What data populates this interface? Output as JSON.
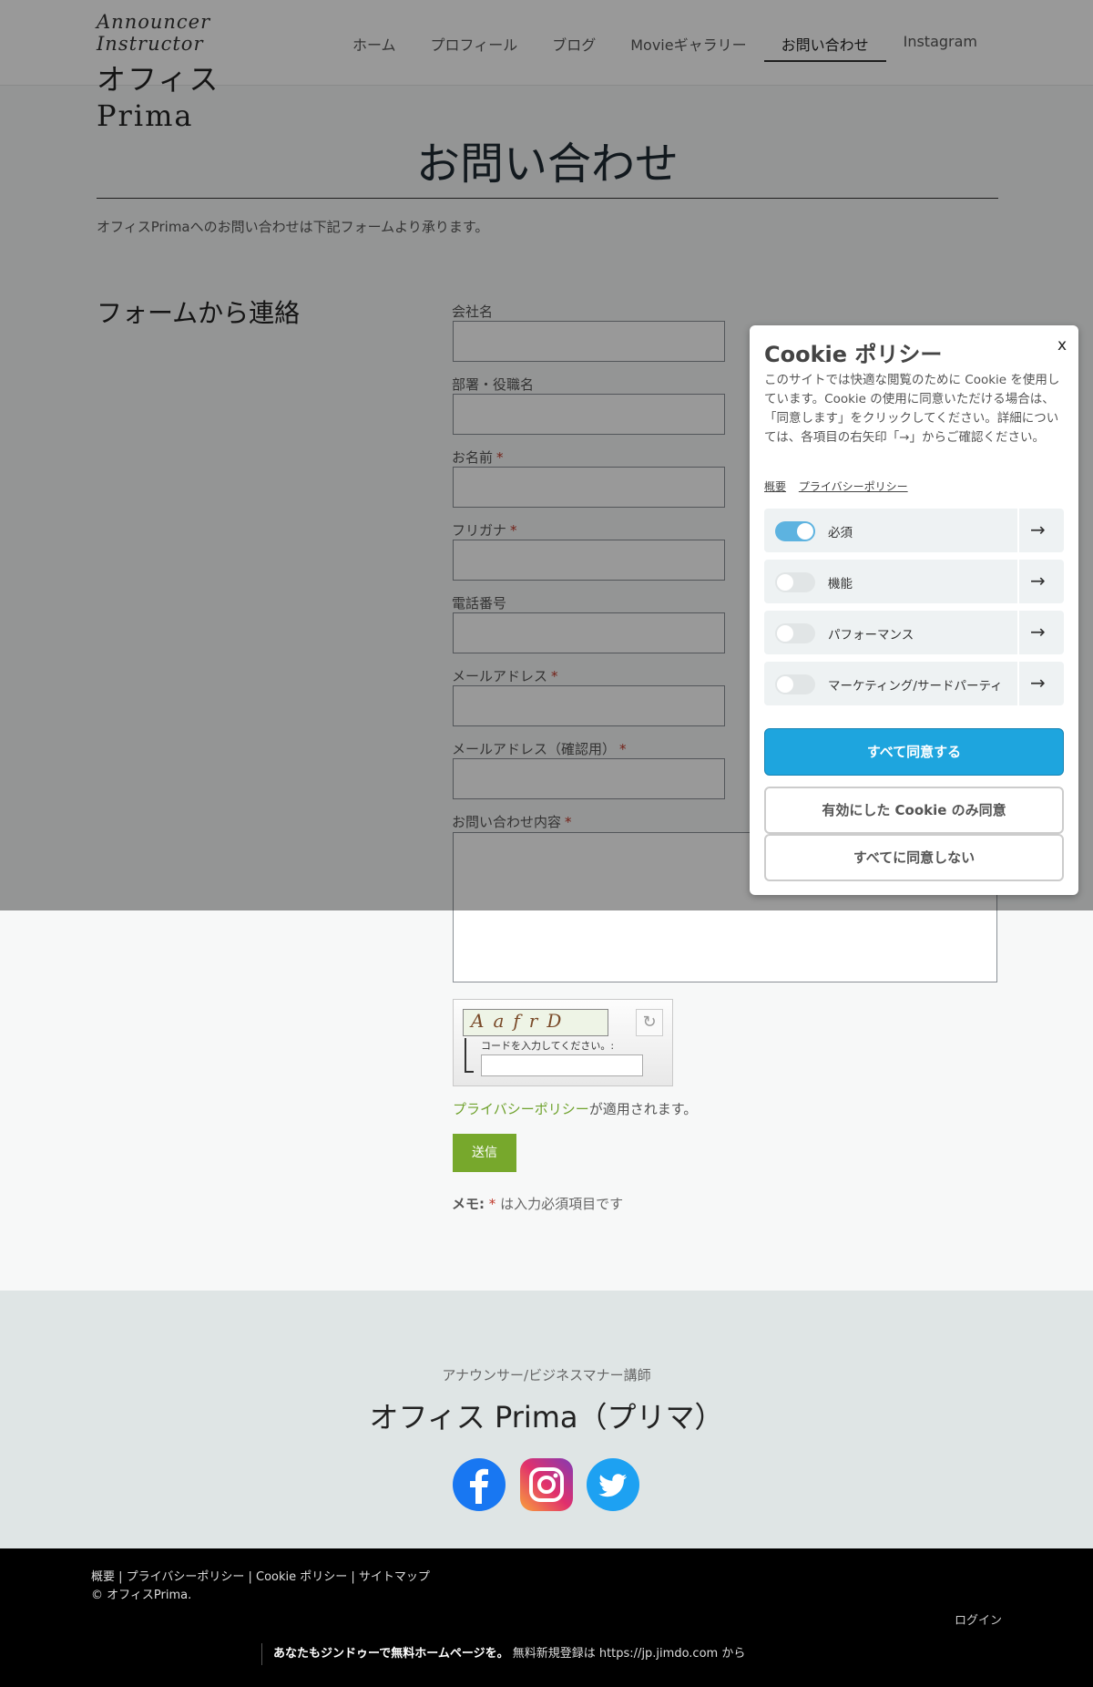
{
  "header": {
    "logo_script": "Announcer Instructor",
    "logo_brand": "オフィスPrima",
    "nav": [
      {
        "label": "ホーム"
      },
      {
        "label": "プロフィール"
      },
      {
        "label": "ブログ"
      },
      {
        "label": "Movieギャラリー"
      },
      {
        "label": "お問い合わせ",
        "active": true
      },
      {
        "label": "Instagram"
      }
    ]
  },
  "main": {
    "title": "お問い合わせ",
    "intro": "オフィスPrimaへのお問い合わせは下記フォームより承ります。",
    "section_heading": "フォームから連絡"
  },
  "form": {
    "fields": [
      {
        "label": "会社名",
        "required": false
      },
      {
        "label": "部署・役職名",
        "required": false
      },
      {
        "label": "お名前",
        "required": true
      },
      {
        "label": "フリガナ",
        "required": true
      },
      {
        "label": "電話番号",
        "required": false
      },
      {
        "label": "メールアドレス",
        "required": true
      },
      {
        "label": "メールアドレス（確認用）",
        "required": true
      },
      {
        "label": "お問い合わせ内容",
        "required": true
      }
    ],
    "required_mark": "*",
    "captcha_text": "AafrD",
    "captcha_label": "コードを入力してください。:",
    "privacy_link": "プライバシーポリシー",
    "privacy_suffix": "が適用されます。",
    "submit_label": "送信",
    "memo_prefix": "メモ:",
    "memo_star": "*",
    "memo_suffix": "は入力必須項目です"
  },
  "footer": {
    "subtitle": "アナウンサー/ビジネスマナー講師",
    "name": "オフィス Prima（プリマ）",
    "social": [
      "facebook",
      "instagram",
      "twitter"
    ],
    "links": "概要 | プライバシーポリシー | Cookie ポリシー | サイトマップ",
    "copyright": "© オフィスPrima.",
    "login": "ログイン",
    "jimdo_bold": "あなたもジンドゥーで無料ホームページを。",
    "jimdo_rest": " 無料新規登録は https://jp.jimdo.com から"
  },
  "cookie": {
    "title": "Cookie ポリシー",
    "close": "x",
    "description": "このサイトでは快適な閲覧のために Cookie を使用しています。Cookie の使用に同意いただける場合は、「同意します」をクリックしてください。詳細については、各項目の右矢印「→」からご確認ください。",
    "links": [
      "概要",
      "プライバシーポリシー"
    ],
    "categories": [
      {
        "label": "必須",
        "enabled": true
      },
      {
        "label": "機能",
        "enabled": false
      },
      {
        "label": "パフォーマンス",
        "enabled": false
      },
      {
        "label": "マーケティング/サードパーティ",
        "enabled": false
      }
    ],
    "arrow": "→",
    "accept_all": "すべて同意する",
    "accept_selected": "有効にした Cookie のみ同意",
    "reject_all": "すべてに同意しない"
  },
  "colors": {
    "accent_green": "#77a82c",
    "cookie_blue": "#1ea5de",
    "toggle_on": "#5db3e0"
  }
}
